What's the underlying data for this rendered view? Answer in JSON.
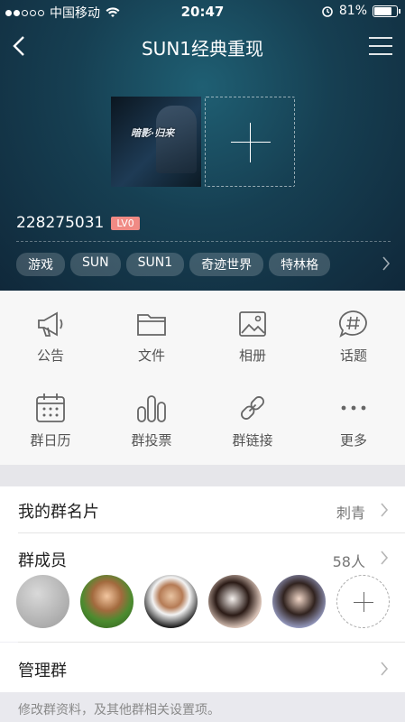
{
  "status_bar": {
    "carrier": "中国移动",
    "time": "20:47",
    "battery": "81%",
    "battery_level": 0.81
  },
  "nav": {
    "title": "SUN1经典重现"
  },
  "cover": {
    "game_title_text": "暗影·归来"
  },
  "group": {
    "id": "228275031",
    "level": "LV0"
  },
  "tags": [
    "游戏",
    "SUN",
    "SUN1",
    "奇迹世界",
    "特林格"
  ],
  "grid": [
    {
      "label": "公告",
      "icon": "megaphone-icon"
    },
    {
      "label": "文件",
      "icon": "folder-icon"
    },
    {
      "label": "相册",
      "icon": "photo-icon"
    },
    {
      "label": "话题",
      "icon": "hashtag-bubble-icon"
    },
    {
      "label": "群日历",
      "icon": "calendar-icon"
    },
    {
      "label": "群投票",
      "icon": "bar-chart-icon"
    },
    {
      "label": "群链接",
      "icon": "link-icon"
    },
    {
      "label": "更多",
      "icon": "more-dots-icon"
    }
  ],
  "my_card": {
    "title": "我的群名片",
    "value": "刺青"
  },
  "members": {
    "title": "群成员",
    "count": "58人"
  },
  "manage": {
    "title": "管理群",
    "note": "修改群资料，及其他群相关设置项。"
  }
}
